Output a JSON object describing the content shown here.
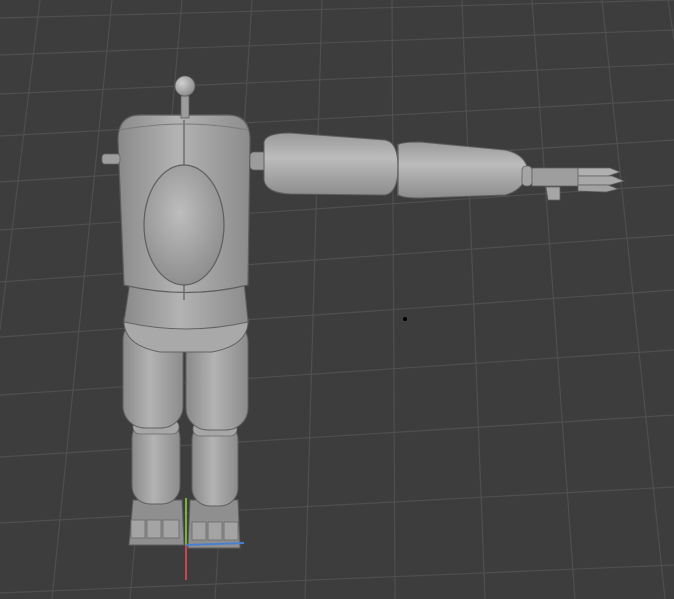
{
  "viewport": {
    "kind": "3d-viewport",
    "model": "robot-character-mesh",
    "pose": "one-arm-raised",
    "shading": "solid",
    "grid": true,
    "colors": {
      "background": "#3d3d3d",
      "grid_line": "#525252",
      "mesh_light": "#b4b4b4",
      "mesh_mid": "#9a9a9a",
      "mesh_dark": "#6f6f6f",
      "mesh_edge": "#5e5e5e",
      "axis_x": "#c8464f",
      "axis_y": "#79b43a",
      "axis_z": "#4a7fd0",
      "origin_marker": "#000000"
    }
  }
}
